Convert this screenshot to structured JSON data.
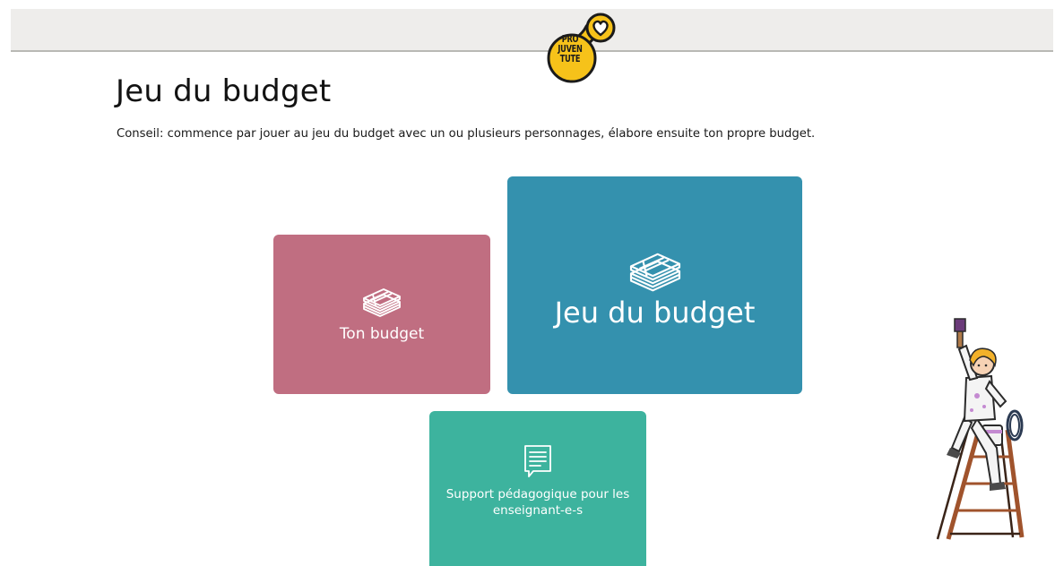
{
  "header": {
    "logo": {
      "icon": "pro-juventute-logo",
      "brand_color": "#f6c21a",
      "lines": [
        "PRO",
        "JUVEN",
        "TUTE"
      ]
    }
  },
  "main": {
    "title": "Jeu du budget",
    "tip": "Conseil: commence par jouer au jeu du budget avec un ou plusieurs personnages, élabore ensuite ton propre budget."
  },
  "cards": {
    "ton_budget": {
      "label": "Ton budget",
      "icon": "money-stack-icon",
      "color": "#c06e81"
    },
    "jeu_du_budget": {
      "label": "Jeu du budget",
      "icon": "money-stack-icon",
      "color": "#3491ae"
    },
    "support": {
      "label": "Support pédagogique pour les enseignant-e-s",
      "icon": "document-icon",
      "color": "#3db39e"
    }
  },
  "illustration": {
    "icon": "painter-on-ladder-illustration"
  }
}
